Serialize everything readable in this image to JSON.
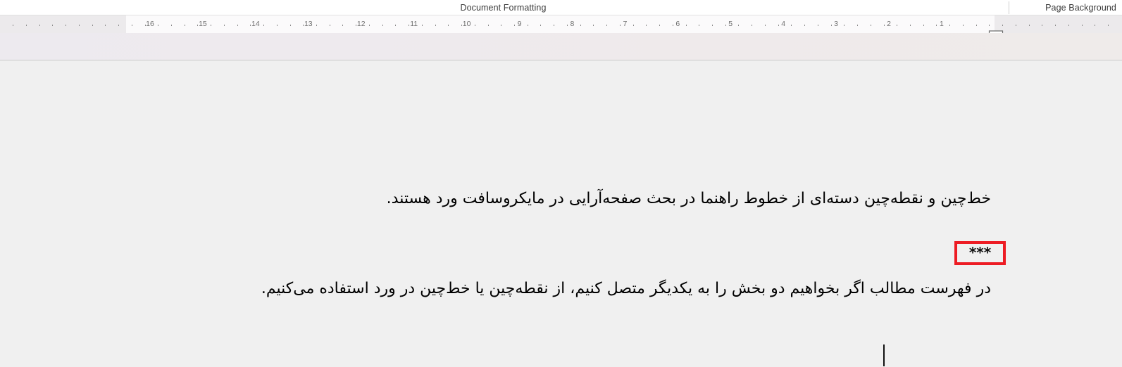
{
  "titlebar": {
    "center_label": "Document Formatting",
    "right_label": "Page Background"
  },
  "ruler": {
    "unit": "cm",
    "orientation": "rtl",
    "numbers": [
      "16",
      "15",
      "14",
      "13",
      "12",
      "11",
      "10",
      "9",
      "8",
      "7",
      "6",
      "5",
      "4",
      "3",
      "2",
      "1"
    ],
    "left_indent_marker": "first-line-indent-marker",
    "right_indent_marker": "hanging-and-left-indent-marker"
  },
  "document": {
    "paragraph_1": "خط‌چین و نقطه‌چین دسته‌ای از خطوط راهنما در بحث صفحه‌آرایی در مایکروسافت ورد هستند.",
    "paragraph_2": "***",
    "paragraph_3": "در فهرست مطالب اگر بخواهیم دو بخش را به یکدیگر متصل کنیم، از نقطه‌چین یا خط‌چین در ورد استفاده می‌کنیم."
  },
  "colors": {
    "highlight_box": "#ed1c24",
    "page_background": "#f0f0f0",
    "ruler_background": "#eceaec",
    "ruler_active": "#fbfafb",
    "titlebar_background": "#ffffff",
    "text": "#000000"
  }
}
